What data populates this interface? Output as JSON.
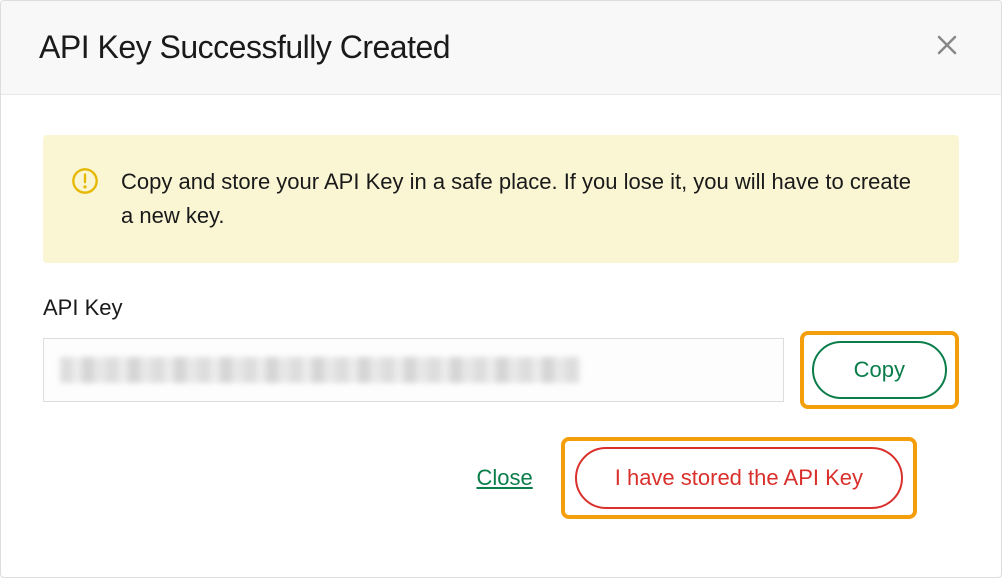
{
  "modal": {
    "title": "API Key Successfully Created",
    "warning": "Copy and store your API Key in a safe place. If you lose it, you will have to create a new key.",
    "field_label": "API Key",
    "key_value_redacted": true,
    "copy_label": "Copy",
    "close_label": "Close",
    "confirm_label": "I have stored the API Key"
  },
  "colors": {
    "accent_green": "#0a7d4a",
    "danger_red": "#d9302c",
    "highlight_orange": "#f59e0b",
    "warning_bg": "#faf6d4",
    "warning_icon": "#e6b800"
  }
}
